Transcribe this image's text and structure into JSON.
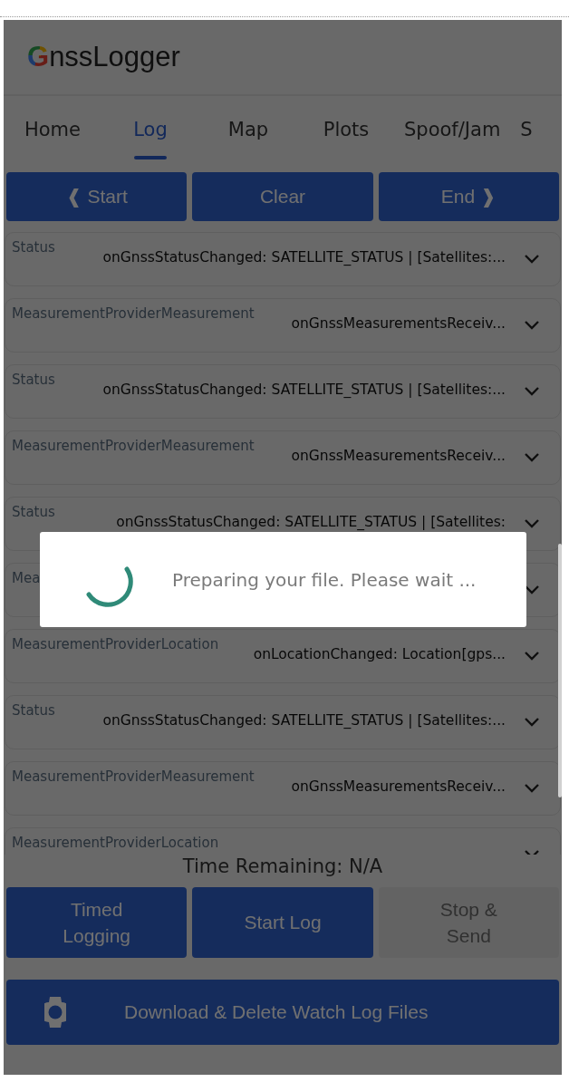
{
  "app_title": "GnssLogger",
  "tabs": [
    {
      "label": "Home",
      "selected": false
    },
    {
      "label": "Log",
      "selected": true
    },
    {
      "label": "Map",
      "selected": false
    },
    {
      "label": "Plots",
      "selected": false
    },
    {
      "label": "Spoof/Jam",
      "selected": false
    },
    {
      "label": "S",
      "selected": false
    }
  ],
  "log_controls": [
    "❰ Start",
    "Clear",
    "End ❱"
  ],
  "log_entries": [
    {
      "tag": "Status",
      "message": "onGnssStatusChanged: SATELLITE_STATUS | [Satellites:..."
    },
    {
      "tag": "MeasurementProviderMeasurement",
      "message": "onGnssMeasurementsReceiv..."
    },
    {
      "tag": "Status",
      "message": "onGnssStatusChanged: SATELLITE_STATUS | [Satellites:..."
    },
    {
      "tag": "MeasurementProviderMeasurement",
      "message": "onGnssMeasurementsReceiv..."
    },
    {
      "tag": "Status",
      "message": "onGnssStatusChanged: SATELLITE_STATUS | [Satellites:"
    },
    {
      "tag": "Mea"
    },
    {
      "tag": "MeasurementProviderLocation",
      "message": "onLocationChanged: Location[gps..."
    },
    {
      "tag": "Status",
      "message": "onGnssStatusChanged: SATELLITE_STATUS | [Satellites:..."
    },
    {
      "tag": "MeasurementProviderMeasurement",
      "message": "onGnssMeasurementsReceiv..."
    },
    {
      "tag": "MeasurementProviderLocation"
    }
  ],
  "time_remaining": "Time Remaining: N/A",
  "actions": [
    {
      "label": "Timed Logging",
      "disabled": false
    },
    {
      "label": "Start Log",
      "disabled": false
    },
    {
      "label": "Stop & Send",
      "disabled": true
    }
  ],
  "watch_button": "Download & Delete Watch Log Files",
  "dialog": {
    "message": "Preparing your file. Please wait ..."
  }
}
